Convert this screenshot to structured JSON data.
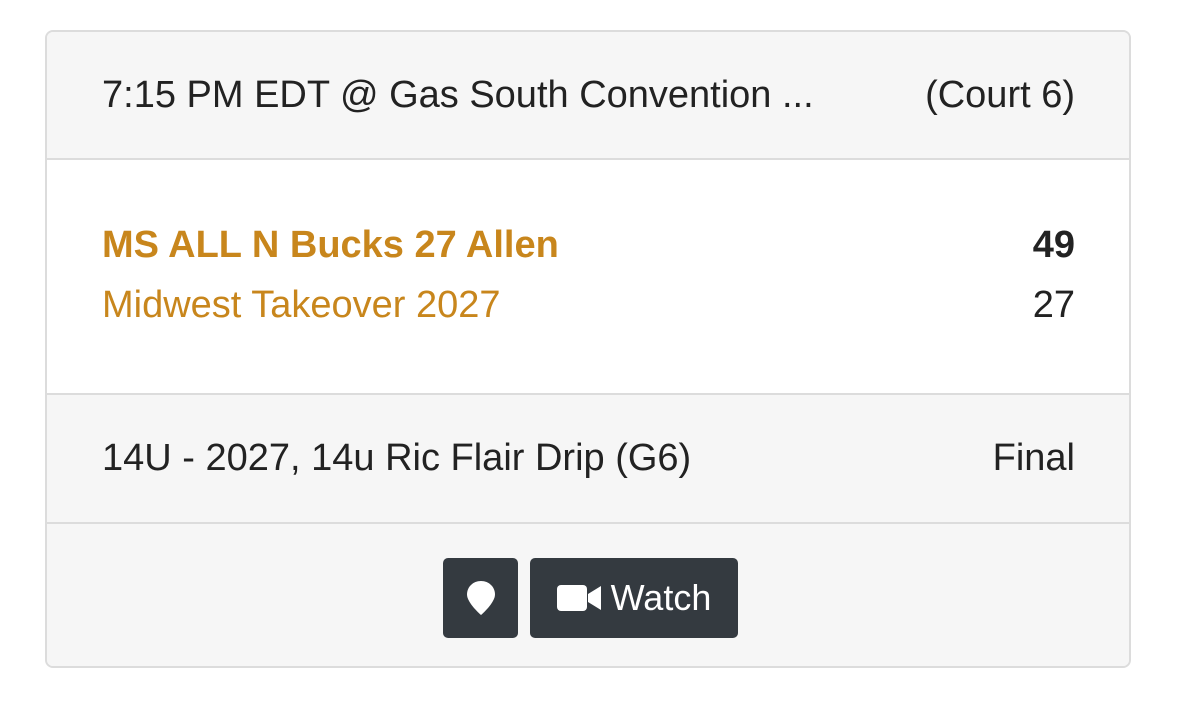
{
  "header": {
    "time_venue": "7:15 PM EDT @ Gas South Convention ...",
    "court": "(Court 6)"
  },
  "teams": [
    {
      "name": "MS ALL N Bucks 27 Allen",
      "score": "49",
      "winner": true
    },
    {
      "name": "Midwest Takeover 2027",
      "score": "27",
      "winner": false
    }
  ],
  "info": {
    "division": "14U - 2027, 14u Ric Flair Drip (G6)",
    "status": "Final"
  },
  "actions": {
    "map_icon": "map-marker-icon",
    "watch_icon": "video-camera-icon",
    "watch_label": "Watch"
  },
  "colors": {
    "team_link": "#c8861c",
    "button_bg": "#343a40",
    "panel_bg": "#f6f6f6",
    "border": "#dcdcdc"
  }
}
